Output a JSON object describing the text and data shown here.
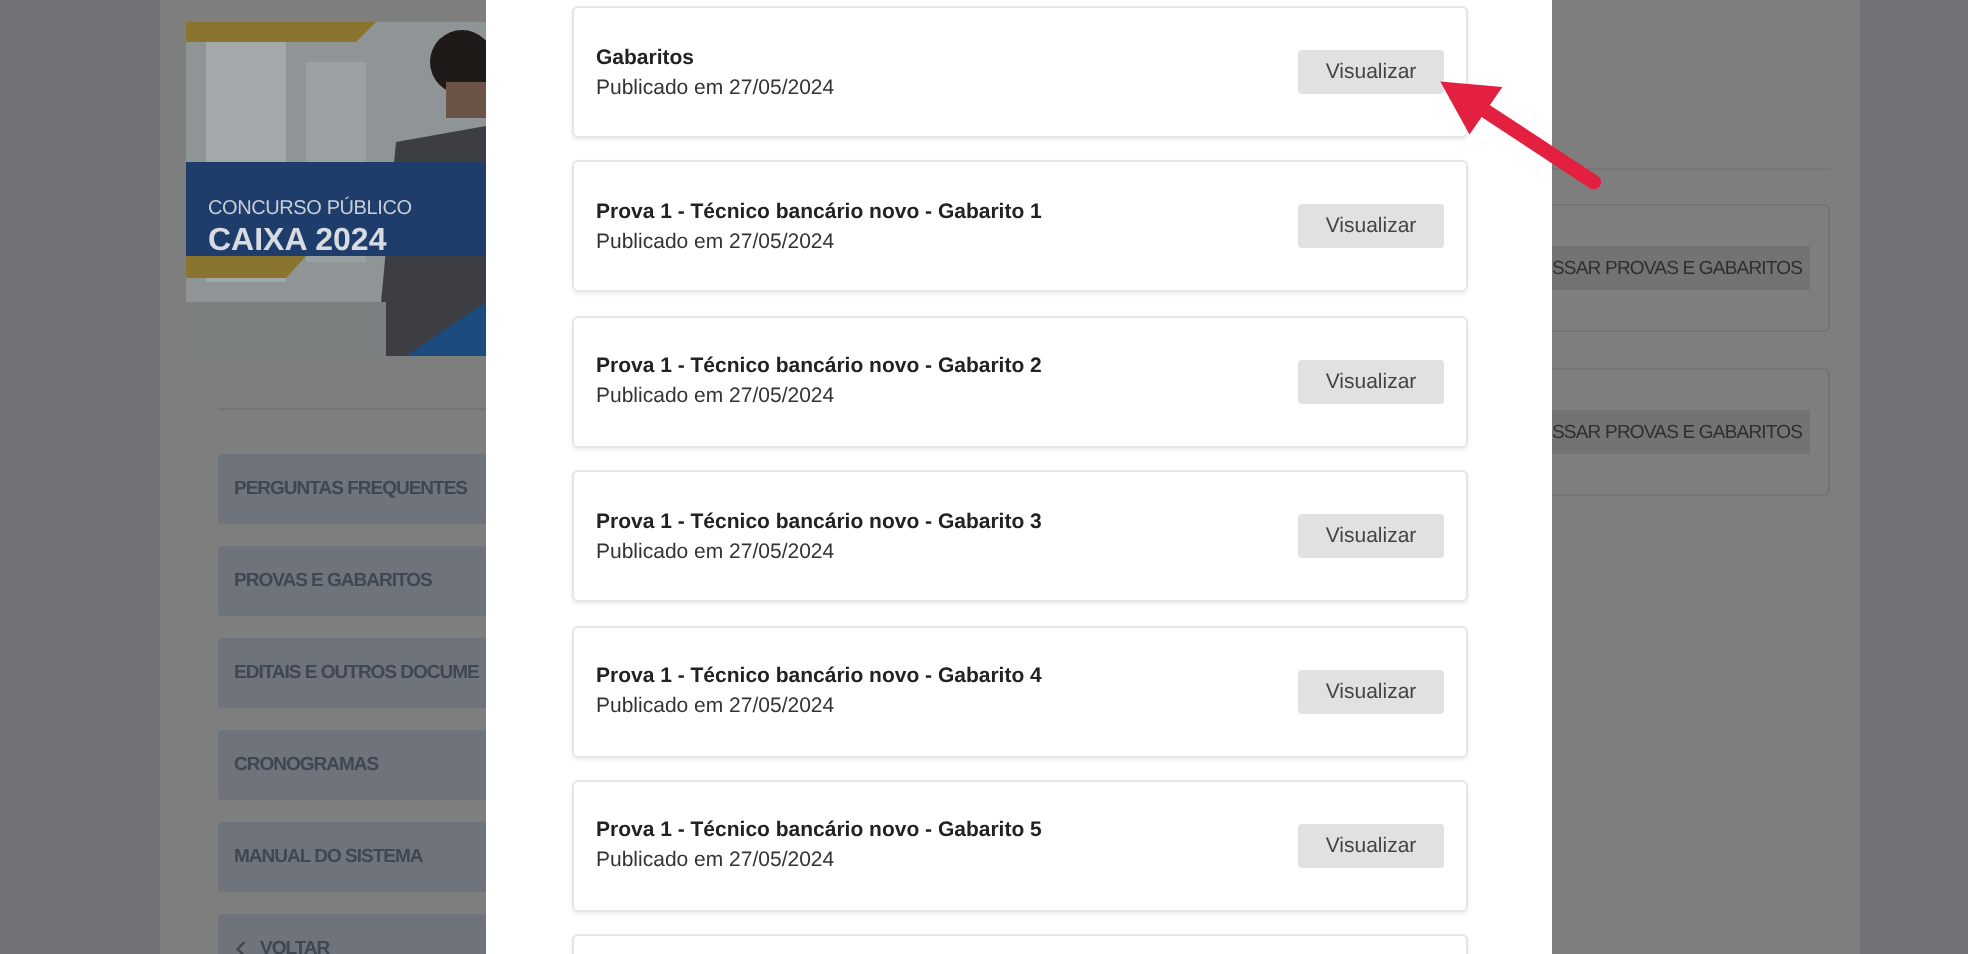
{
  "banner": {
    "kind": "picture",
    "overline": "CONCURSO PÚBLICO",
    "title": "CAIXA 2024"
  },
  "sidebar": {
    "items": [
      {
        "label": "PERGUNTAS FREQUENTES"
      },
      {
        "label": "PROVAS E GABARITOS"
      },
      {
        "label": "EDITAIS E OUTROS DOCUME"
      },
      {
        "label": "CRONOGRAMAS"
      },
      {
        "label": "MANUAL DO SISTEMA"
      }
    ],
    "back": "VOLTAR"
  },
  "right_cards": [
    {
      "button": "SSAR PROVAS E GABARITOS"
    },
    {
      "button": "SSAR PROVAS E GABARITOS"
    }
  ],
  "modal": {
    "items": [
      {
        "title": "Gabaritos",
        "published": "Publicado em 27/05/2024",
        "button": "Visualizar"
      },
      {
        "title": "Prova 1 - Técnico bancário novo - Gabarito 1",
        "published": "Publicado em 27/05/2024",
        "button": "Visualizar"
      },
      {
        "title": "Prova 1 - Técnico bancário novo - Gabarito 2",
        "published": "Publicado em 27/05/2024",
        "button": "Visualizar"
      },
      {
        "title": "Prova 1 - Técnico bancário novo - Gabarito 3",
        "published": "Publicado em 27/05/2024",
        "button": "Visualizar"
      },
      {
        "title": "Prova 1 - Técnico bancário novo - Gabarito 4",
        "published": "Publicado em 27/05/2024",
        "button": "Visualizar"
      },
      {
        "title": "Prova 1 - Técnico bancário novo - Gabarito 5",
        "published": "Publicado em 27/05/2024",
        "button": "Visualizar"
      }
    ]
  }
}
